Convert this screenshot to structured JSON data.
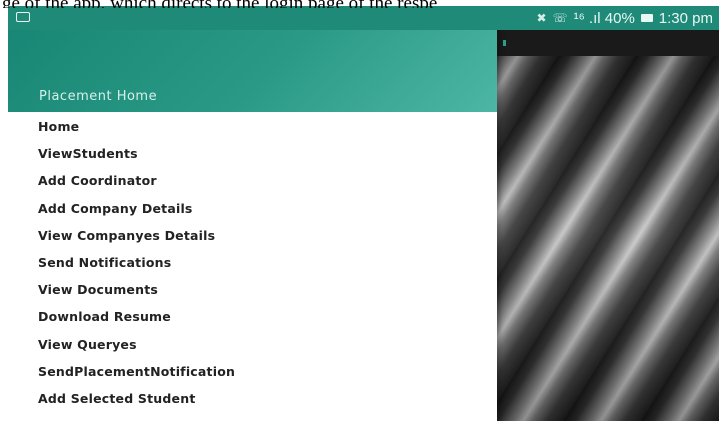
{
  "document": {
    "caption_fragment": "ge of the app, which directs to the login page of the respe"
  },
  "status_bar": {
    "right_text": "¹⁶ .ıl 40%",
    "time": "1:30 pm",
    "icons": [
      "image-icon",
      "mute-icon",
      "volte-icon",
      "signal-icon",
      "battery-icon"
    ],
    "color": "#1f8a78"
  },
  "drawer": {
    "header_title": "Placement Home",
    "header_colors": [
      "#178573",
      "#4db6a4"
    ],
    "items": [
      {
        "label": "Home"
      },
      {
        "label": "ViewStudents"
      },
      {
        "label": "Add Coordinator"
      },
      {
        "label": "Add Company Details"
      },
      {
        "label": "View Companyes Details"
      },
      {
        "label": "Send Notifications"
      },
      {
        "label": "View Documents"
      },
      {
        "label": "Download Resume"
      },
      {
        "label": "View Queryes"
      },
      {
        "label": "SendPlacementNotification"
      },
      {
        "label": "Add Selected Student"
      }
    ]
  }
}
